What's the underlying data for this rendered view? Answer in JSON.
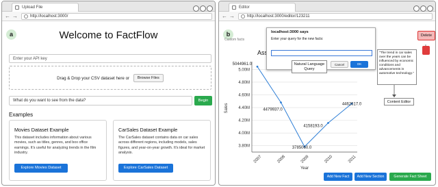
{
  "left_window": {
    "tab_title": "Upload File",
    "url": "http://localhost:3000/",
    "panel_badge": "a",
    "heading": "Welcome to FactFlow",
    "api_key_placeholder": "Enter your API key",
    "drop_text": "Drag & Drop your CSV dataset here or",
    "browse_label": "Browse Files",
    "question_placeholder": "What do you want to see from the data?",
    "begin_label": "Begin",
    "examples_title": "Examples",
    "cards": [
      {
        "title": "Movies Dataset Example",
        "description": "This dataset includes information about various movies, such as titles, genres, and box office earnings. It's useful for analyzing trends in the film industry.",
        "button": "Explore Movies Dataset"
      },
      {
        "title": "CarSales Dataset Example",
        "description": "The CarSales dataset contains data on car sales across different regions, including models, sales figures, and year-on-year growth. It's ideal for market analysis.",
        "button": "Explore CarSales Dataset"
      }
    ]
  },
  "right_window": {
    "tab_title": "Editor",
    "url": "http://localhost:3000/editor/123211",
    "panel_badge": "b",
    "partial_label": "Custom facts",
    "title_fragment": "Associ",
    "dialog": {
      "title": "localhost:3000 says",
      "message": "Enter your query for the new facts:",
      "cancel": "Cancel",
      "ok": "OK"
    },
    "nl_query_label": "Natural Language Query",
    "delete_label": "Delete",
    "fact_text": "\"The trend in car sales over the years can be influenced by economic conditions and advancements in automotive technology.\"",
    "content_editor_label": "Content Editor",
    "buttons": {
      "add_new_fact": "Add New Fact",
      "add_new_section": "Add New Section",
      "generate_fact_sheet": "Generate Fact Sheet"
    },
    "colors": {
      "line": "#2f7fd6",
      "primary": "#1a73d9",
      "success": "#2aa94d",
      "delete": "#f4b8b8",
      "delete_icon": "#e03c3c"
    }
  },
  "chart_data": {
    "type": "line",
    "x": [
      "2007",
      "2008",
      "2009",
      "2010",
      "2011"
    ],
    "values": [
      5044961.0,
      4479937.0,
      3785060.0,
      4158193.0,
      4462617.0
    ],
    "data_labels": [
      "5044961.0",
      "4479937.0",
      "3785060.0",
      "4158193.0",
      "4462617.0"
    ],
    "yticks": [
      "3.80M",
      "4.00M",
      "4.20M",
      "4.40M",
      "4.60M",
      "4.80M",
      "5.00M"
    ],
    "ylim": [
      3700000,
      5080000
    ],
    "xlabel": "Year",
    "ylabel": "Sales",
    "grid": true
  }
}
